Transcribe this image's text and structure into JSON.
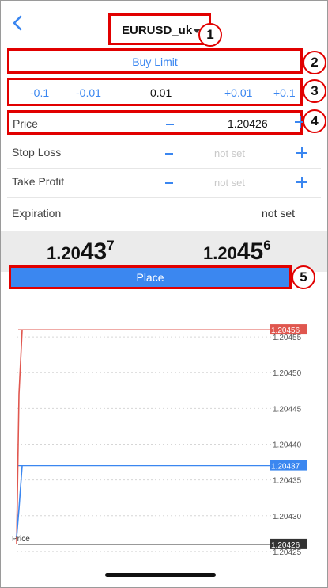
{
  "header": {
    "symbol": "EURUSD_uk"
  },
  "badges": [
    "1",
    "2",
    "3",
    "4",
    "5"
  ],
  "order_type": "Buy Limit",
  "steps": [
    "-0.1",
    "-0.01",
    "0.01",
    "+0.01",
    "+0.1"
  ],
  "fields": {
    "price": {
      "label": "Price",
      "value": "1.20426"
    },
    "stop_loss": {
      "label": "Stop Loss",
      "value": "not set"
    },
    "take_profit": {
      "label": "Take Profit",
      "value": "not set"
    },
    "expiration": {
      "label": "Expiration",
      "value": "not set"
    }
  },
  "quotes": {
    "bid": {
      "prefix": "1.20",
      "big": "43",
      "sup": "7"
    },
    "ask": {
      "prefix": "1.20",
      "big": "45",
      "sup": "6"
    }
  },
  "place_label": "Place",
  "chart_data": {
    "type": "line",
    "y_ticks": [
      "1.20455",
      "1.20450",
      "1.20445",
      "1.20440",
      "1.20435",
      "1.20430",
      "1.20425"
    ],
    "y_range": [
      1.20422,
      1.20459
    ],
    "markers": [
      {
        "label": "1.20456",
        "value": 1.20456,
        "color": "#e0574f"
      },
      {
        "label": "1.20437",
        "value": 1.20437,
        "color": "#3b87f0"
      },
      {
        "label": "1.20426",
        "value": 1.20426,
        "color": "#333333"
      }
    ],
    "price_line_label": "Price",
    "series": [
      {
        "values": [
          1.20426,
          1.20447,
          1.20456
        ],
        "color": "#e0574f"
      },
      {
        "values": [
          1.20427,
          1.20431,
          1.20437
        ],
        "color": "#3b87f0"
      }
    ],
    "grid": true
  }
}
